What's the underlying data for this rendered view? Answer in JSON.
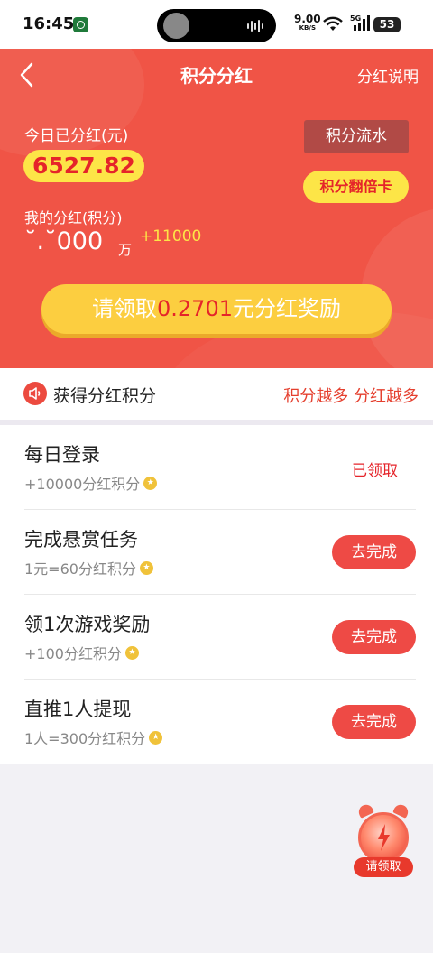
{
  "status_bar": {
    "time": "16:45",
    "net_speed": "9.00",
    "net_unit": "KB/S",
    "signal": "5G",
    "battery": "53"
  },
  "header": {
    "title": "积分分红",
    "help_link": "分红说明",
    "today_label": "今日已分红(元)",
    "today_value": "6527.82",
    "flow_button": "积分流水",
    "double_card_button": "积分翻倍卡",
    "my_label": "我的分红(积分)",
    "my_value": "˘.˘000",
    "my_unit": "万",
    "my_plus": "+11000",
    "claim_prefix": "请领取",
    "claim_amount": "0.2701",
    "claim_suffix": "元分红奖励",
    "colors": {
      "background": "#f05446",
      "gold": "#fde547",
      "accent_red": "#e5242a"
    }
  },
  "notice": {
    "icon": "speaker-icon",
    "text": "获得分红积分",
    "slogan": "积分越多 分红越多"
  },
  "tasks": [
    {
      "title": "每日登录",
      "reward": "+10000分红积分",
      "status": "已领取",
      "action": null
    },
    {
      "title": "完成悬赏任务",
      "reward": "1元=60分红积分",
      "status": null,
      "action": "去完成"
    },
    {
      "title": "领1次游戏奖励",
      "reward": "+100分红积分",
      "status": null,
      "action": "去完成"
    },
    {
      "title": "直推1人提现",
      "reward": "1人=300分红积分",
      "status": null,
      "action": "去完成"
    }
  ],
  "float_widget": {
    "icon": "alarm-clock-icon",
    "label": "请领取"
  }
}
